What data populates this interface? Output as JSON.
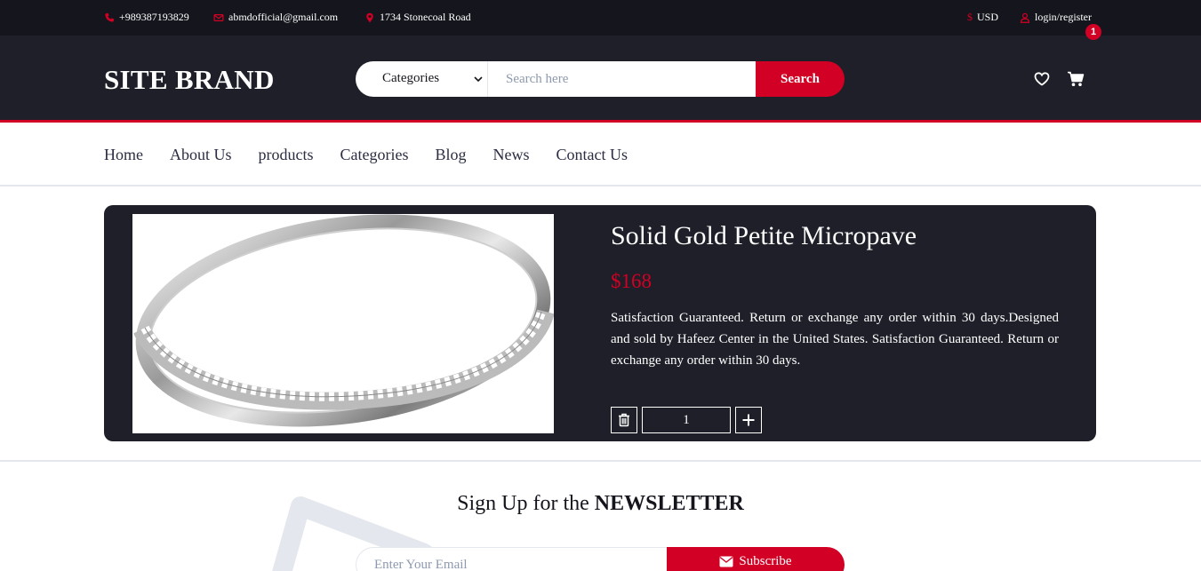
{
  "colors": {
    "accent": "#D10024",
    "dark": "#15161d",
    "header": "#1e1f29",
    "card": "#1e1f29"
  },
  "topbar": {
    "phone": "+989387193829",
    "email": "abmdofficial@gmail.com",
    "address": "1734 Stonecoal Road",
    "currency": "USD",
    "account": "login/register",
    "icons": [
      "phone-icon",
      "envelope-icon",
      "map-marker-icon",
      "dollar-icon",
      "user-icon"
    ]
  },
  "header": {
    "brand": "SITE BRAND",
    "search": {
      "category_selected": "Categories",
      "placeholder": "Search here",
      "button": "Search"
    },
    "cart_count": "1"
  },
  "nav": {
    "items": [
      "Home",
      "About Us",
      "products",
      "Categories",
      "Blog",
      "News",
      "Contact Us"
    ]
  },
  "product": {
    "title": "Solid Gold Petite Micropave",
    "price": "$168",
    "description": "Satisfaction Guaranteed. Return or exchange any order within 30 days.Designed and sold by Hafeez Center in the United States. Satisfaction Guaranteed. Return or exchange any order within 30 days.",
    "quantity": "1",
    "image": "ring-image"
  },
  "newsletter": {
    "title_prefix": "Sign Up for the ",
    "title_bold": "NEWSLETTER",
    "email_placeholder": "Enter Your Email",
    "subscribe": "Subscribe"
  }
}
